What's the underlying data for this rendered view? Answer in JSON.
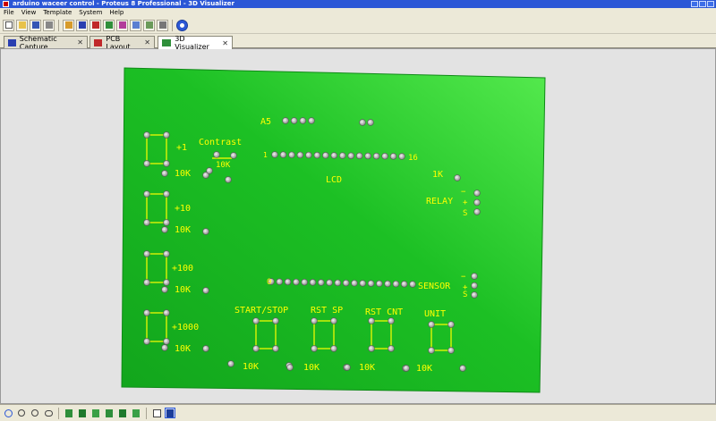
{
  "window": {
    "title": "arduino waceer control - Proteus 8 Professional - 3D Visualizer"
  },
  "menu": [
    "File",
    "View",
    "Template",
    "System",
    "Help"
  ],
  "tabs": [
    {
      "label": "Schematic Capture",
      "close": "✕",
      "icon": "schematic-icon",
      "color": "#2a3fb0"
    },
    {
      "label": "PCB Layout",
      "close": "✕",
      "icon": "pcb-icon",
      "color": "#c0282a"
    },
    {
      "label": "3D Visualizer",
      "close": "✕",
      "icon": "3d-visualizer-icon",
      "color": "#2f8f3a"
    }
  ],
  "colors": {
    "board": "#17b221",
    "board_highlight": "#4fe64a",
    "silkscreen": "#ffff00",
    "viewport": "#e3e3e3"
  },
  "board": {
    "labels": {
      "a5": "A5",
      "contrast": "Contrast",
      "lcd": "LCD",
      "lcd_pin1": "1",
      "lcd_pin16": "16",
      "r_1k": "1K",
      "relay": "RELAY",
      "sensor": "SENSOR",
      "minus": "−",
      "plus": "+",
      "s": "S",
      "zero": "0",
      "step_1": "+1",
      "step_10": "+10",
      "step_100": "+100",
      "step_1000": "+1000",
      "r_10k": "10K",
      "start_stop": "START/STOP",
      "rst_sp": "RST SP",
      "rst_cnt": "RST CNT",
      "unit": "UNIT"
    }
  }
}
